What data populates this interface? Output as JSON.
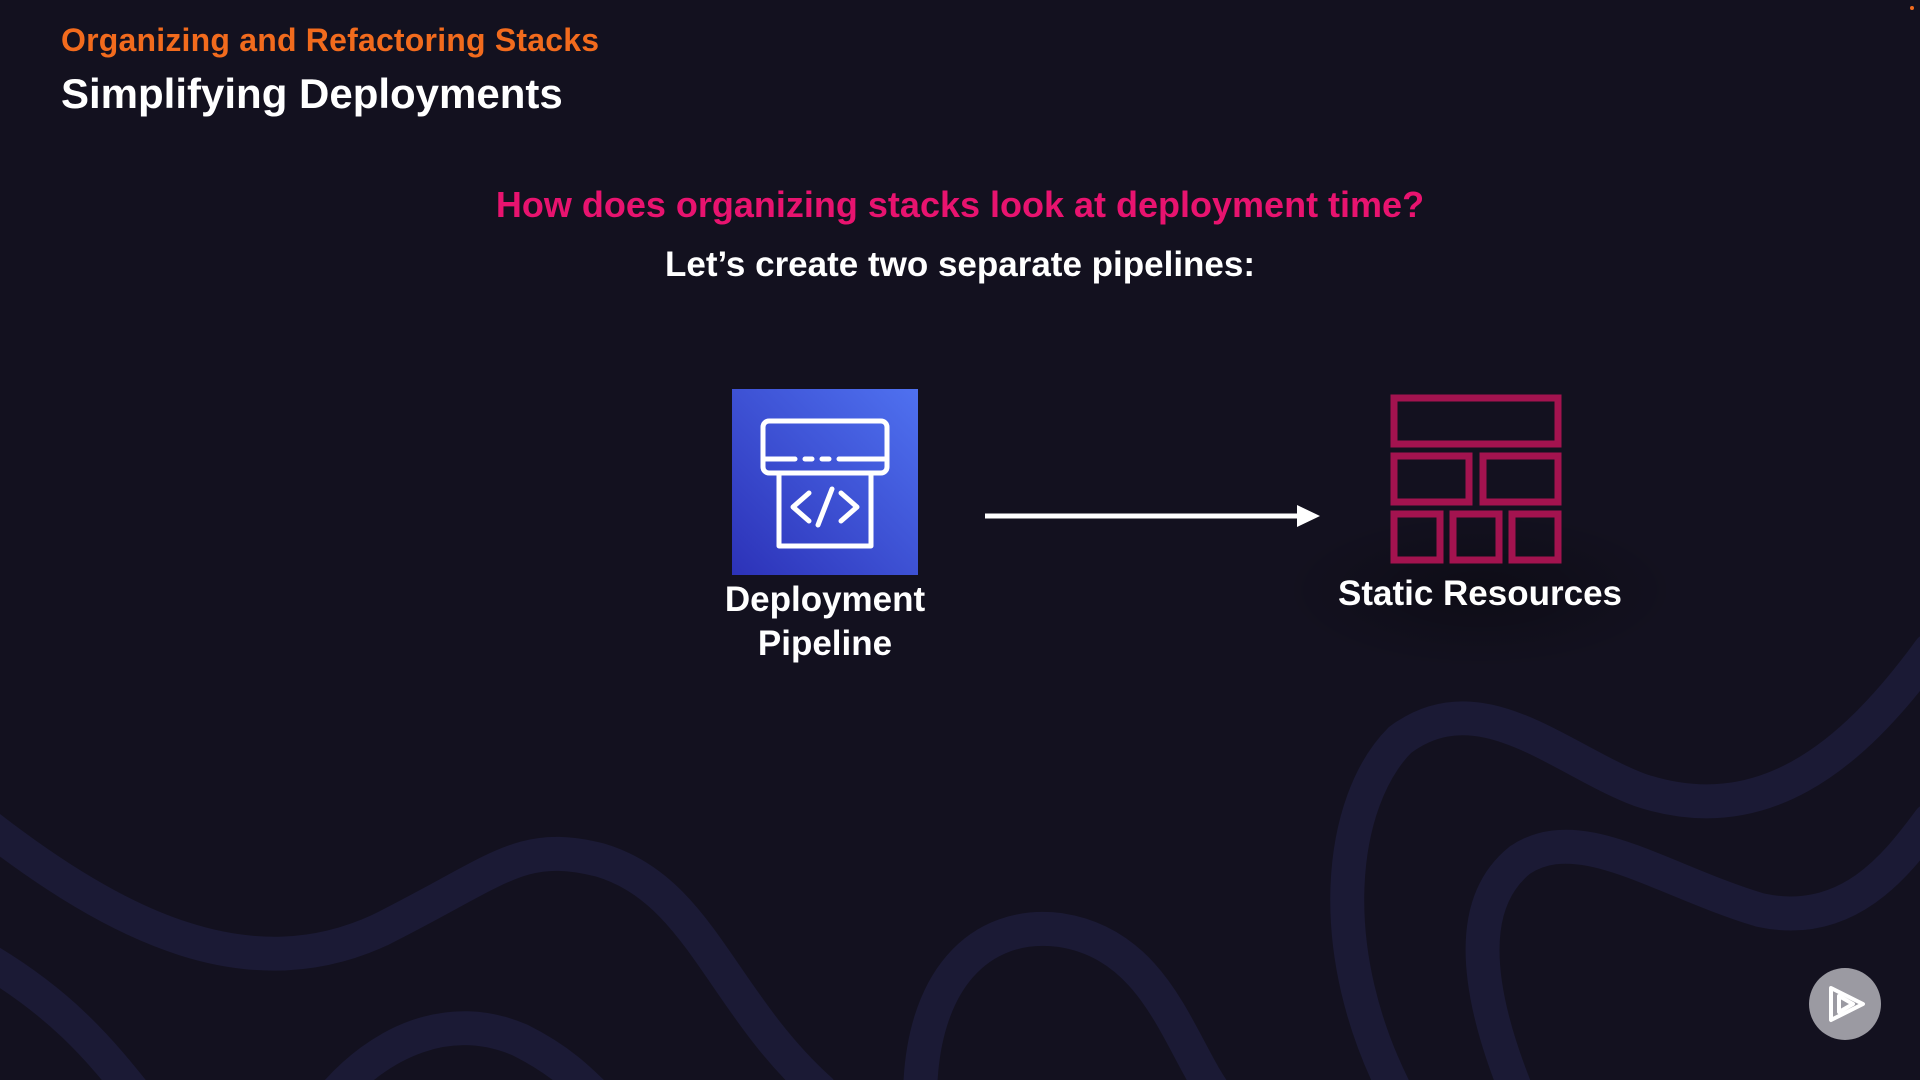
{
  "slide": {
    "section_title": "Organizing and Refactoring Stacks",
    "title": "Simplifying Deployments",
    "question": "How does organizing stacks look at deployment time?",
    "subtitle": "Let’s create two separate pipelines:"
  },
  "diagram": {
    "nodes": [
      {
        "id": "deployment-pipeline",
        "label_lines": [
          "Deployment",
          "Pipeline"
        ],
        "icon": "code-pipeline-icon"
      },
      {
        "id": "static-resources",
        "label": "Static Resources",
        "icon": "grid-blocks-icon"
      }
    ],
    "edges": [
      {
        "from": "deployment-pipeline",
        "to": "static-resources",
        "style": "arrow"
      }
    ]
  },
  "colors": {
    "background": "#13111f",
    "section_title": "#f26b1d",
    "question": "#e8136f",
    "pipeline_icon_gradient": [
      "#2c32b8",
      "#4f71f0"
    ],
    "static_icon": "#a3134f",
    "text": "#ffffff",
    "wave": "#1b1a35"
  },
  "controls": {
    "play_button_icon": "play-logo-icon"
  }
}
